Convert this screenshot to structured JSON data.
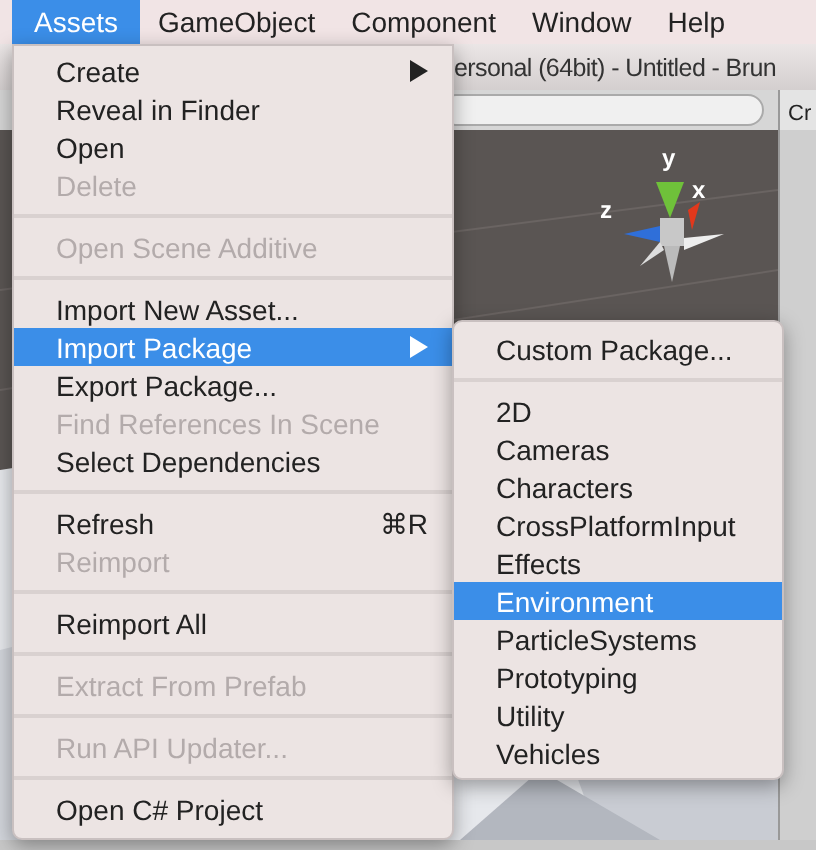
{
  "menubar": [
    {
      "label": "Assets",
      "selected": true
    },
    {
      "label": "GameObject",
      "selected": false
    },
    {
      "label": "Component",
      "selected": false
    },
    {
      "label": "Window",
      "selected": false
    },
    {
      "label": "Help",
      "selected": false
    }
  ],
  "window": {
    "title": "ersonal (64bit) - Untitled - Brun",
    "panel_tab": "Cr"
  },
  "scene": {
    "gizmo_labels": [
      "y",
      "x",
      "z"
    ]
  },
  "menu": {
    "items": [
      {
        "kind": "item",
        "label": "Create",
        "disabled": false,
        "selected": false,
        "submenu": true
      },
      {
        "kind": "item",
        "label": "Reveal in Finder",
        "disabled": false,
        "selected": false,
        "submenu": false
      },
      {
        "kind": "item",
        "label": "Open",
        "disabled": false,
        "selected": false,
        "submenu": false
      },
      {
        "kind": "item",
        "label": "Delete",
        "disabled": true,
        "selected": false,
        "submenu": false
      },
      {
        "kind": "separator"
      },
      {
        "kind": "item",
        "label": "Open Scene Additive",
        "disabled": true,
        "selected": false,
        "submenu": false
      },
      {
        "kind": "separator"
      },
      {
        "kind": "item",
        "label": "Import New Asset...",
        "disabled": false,
        "selected": false,
        "submenu": false
      },
      {
        "kind": "item",
        "label": "Import Package",
        "disabled": false,
        "selected": true,
        "submenu": true
      },
      {
        "kind": "item",
        "label": "Export Package...",
        "disabled": false,
        "selected": false,
        "submenu": false
      },
      {
        "kind": "item",
        "label": "Find References In Scene",
        "disabled": true,
        "selected": false,
        "submenu": false
      },
      {
        "kind": "item",
        "label": "Select Dependencies",
        "disabled": false,
        "selected": false,
        "submenu": false
      },
      {
        "kind": "separator"
      },
      {
        "kind": "item",
        "label": "Refresh",
        "disabled": false,
        "selected": false,
        "submenu": false,
        "shortcut": "⌘R"
      },
      {
        "kind": "item",
        "label": "Reimport",
        "disabled": true,
        "selected": false,
        "submenu": false
      },
      {
        "kind": "separator"
      },
      {
        "kind": "item",
        "label": "Reimport All",
        "disabled": false,
        "selected": false,
        "submenu": false
      },
      {
        "kind": "separator"
      },
      {
        "kind": "item",
        "label": "Extract From Prefab",
        "disabled": true,
        "selected": false,
        "submenu": false
      },
      {
        "kind": "separator"
      },
      {
        "kind": "item",
        "label": "Run API Updater...",
        "disabled": true,
        "selected": false,
        "submenu": false
      },
      {
        "kind": "separator"
      },
      {
        "kind": "item",
        "label": "Open C# Project",
        "disabled": false,
        "selected": false,
        "submenu": false
      }
    ]
  },
  "submenu": {
    "items": [
      {
        "kind": "item",
        "label": "Custom Package...",
        "selected": false
      },
      {
        "kind": "separator"
      },
      {
        "kind": "item",
        "label": "2D",
        "selected": false
      },
      {
        "kind": "item",
        "label": "Cameras",
        "selected": false
      },
      {
        "kind": "item",
        "label": "Characters",
        "selected": false
      },
      {
        "kind": "item",
        "label": "CrossPlatformInput",
        "selected": false
      },
      {
        "kind": "item",
        "label": "Effects",
        "selected": false
      },
      {
        "kind": "item",
        "label": "Environment",
        "selected": true
      },
      {
        "kind": "item",
        "label": "ParticleSystems",
        "selected": false
      },
      {
        "kind": "item",
        "label": "Prototyping",
        "selected": false
      },
      {
        "kind": "item",
        "label": "Utility",
        "selected": false
      },
      {
        "kind": "item",
        "label": "Vehicles",
        "selected": false
      }
    ]
  }
}
